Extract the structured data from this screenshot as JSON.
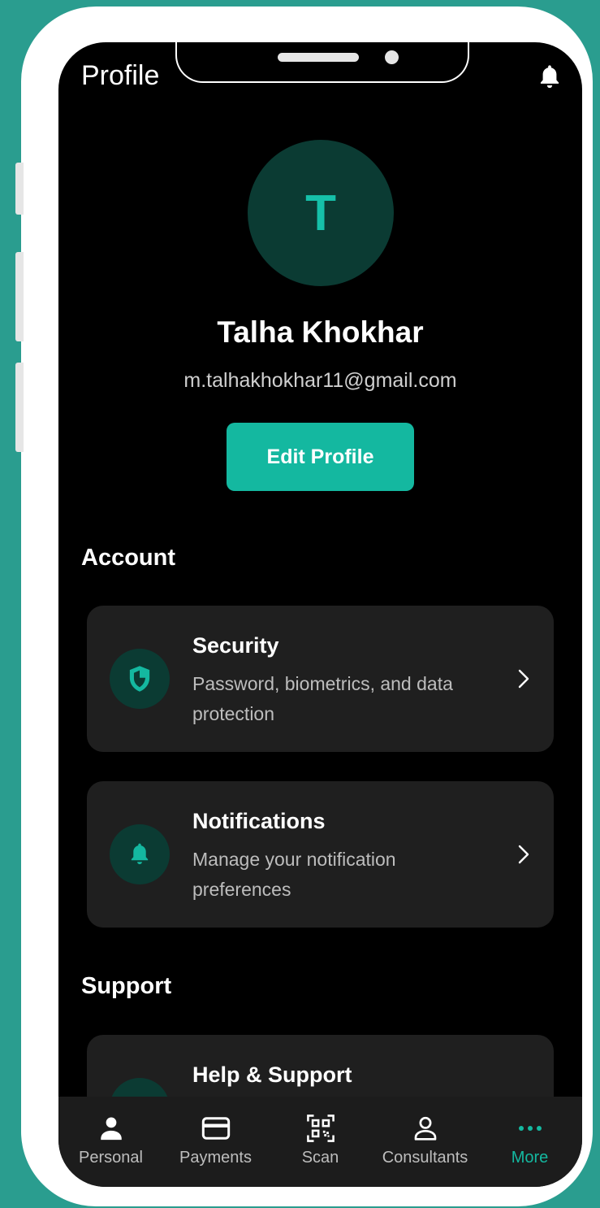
{
  "header": {
    "title": "Profile",
    "bell_icon": "bell-icon"
  },
  "profile": {
    "avatar_initial": "T",
    "name": "Talha Khokhar",
    "email": "m.talhakhokhar11@gmail.com",
    "edit_label": "Edit Profile"
  },
  "account": {
    "title": "Account",
    "items": [
      {
        "icon": "shield-icon",
        "title": "Security",
        "description": "Password, biometrics, and data protection"
      },
      {
        "icon": "bell-icon",
        "title": "Notifications",
        "description": "Manage your notification preferences"
      }
    ]
  },
  "support": {
    "title": "Support",
    "items": [
      {
        "icon": "help-icon",
        "title": "Help & Support"
      }
    ]
  },
  "bottom_nav": {
    "items": [
      {
        "label": "Personal",
        "icon": "person-icon",
        "active": false
      },
      {
        "label": "Payments",
        "icon": "card-icon",
        "active": false
      },
      {
        "label": "Scan",
        "icon": "qr-code-icon",
        "active": false
      },
      {
        "label": "Consultants",
        "icon": "user-outline-icon",
        "active": false
      },
      {
        "label": "More",
        "icon": "more-dots-icon",
        "active": true
      }
    ]
  },
  "colors": {
    "background": "#2a9d8f",
    "accent": "#14b8a0",
    "screen": "#000000",
    "card": "#1f1f1f",
    "icon_circle": "#0b3b33"
  }
}
